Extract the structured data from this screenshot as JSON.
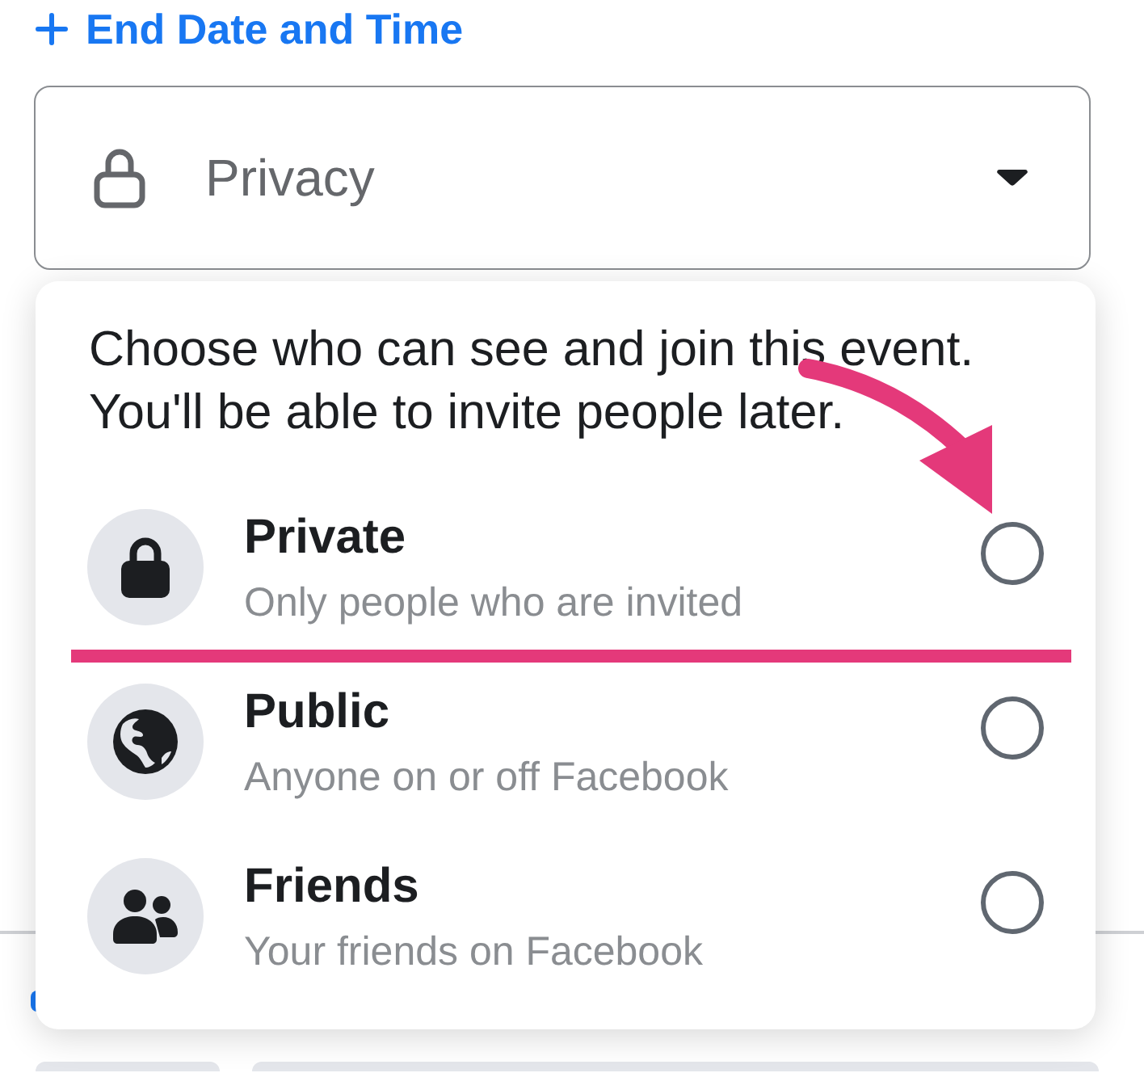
{
  "end_date_link": {
    "label": "End Date and Time"
  },
  "privacy_field": {
    "placeholder": "Privacy"
  },
  "privacy_menu": {
    "description_lines": [
      "Choose who can see and join this event.",
      "You'll be able to invite people later."
    ],
    "options": [
      {
        "title": "Private",
        "subtitle": "Only people who are invited",
        "selected": false
      },
      {
        "title": "Public",
        "subtitle": "Anyone on or off Facebook",
        "selected": false
      },
      {
        "title": "Friends",
        "subtitle": "Your friends on Facebook",
        "selected": false
      }
    ]
  }
}
